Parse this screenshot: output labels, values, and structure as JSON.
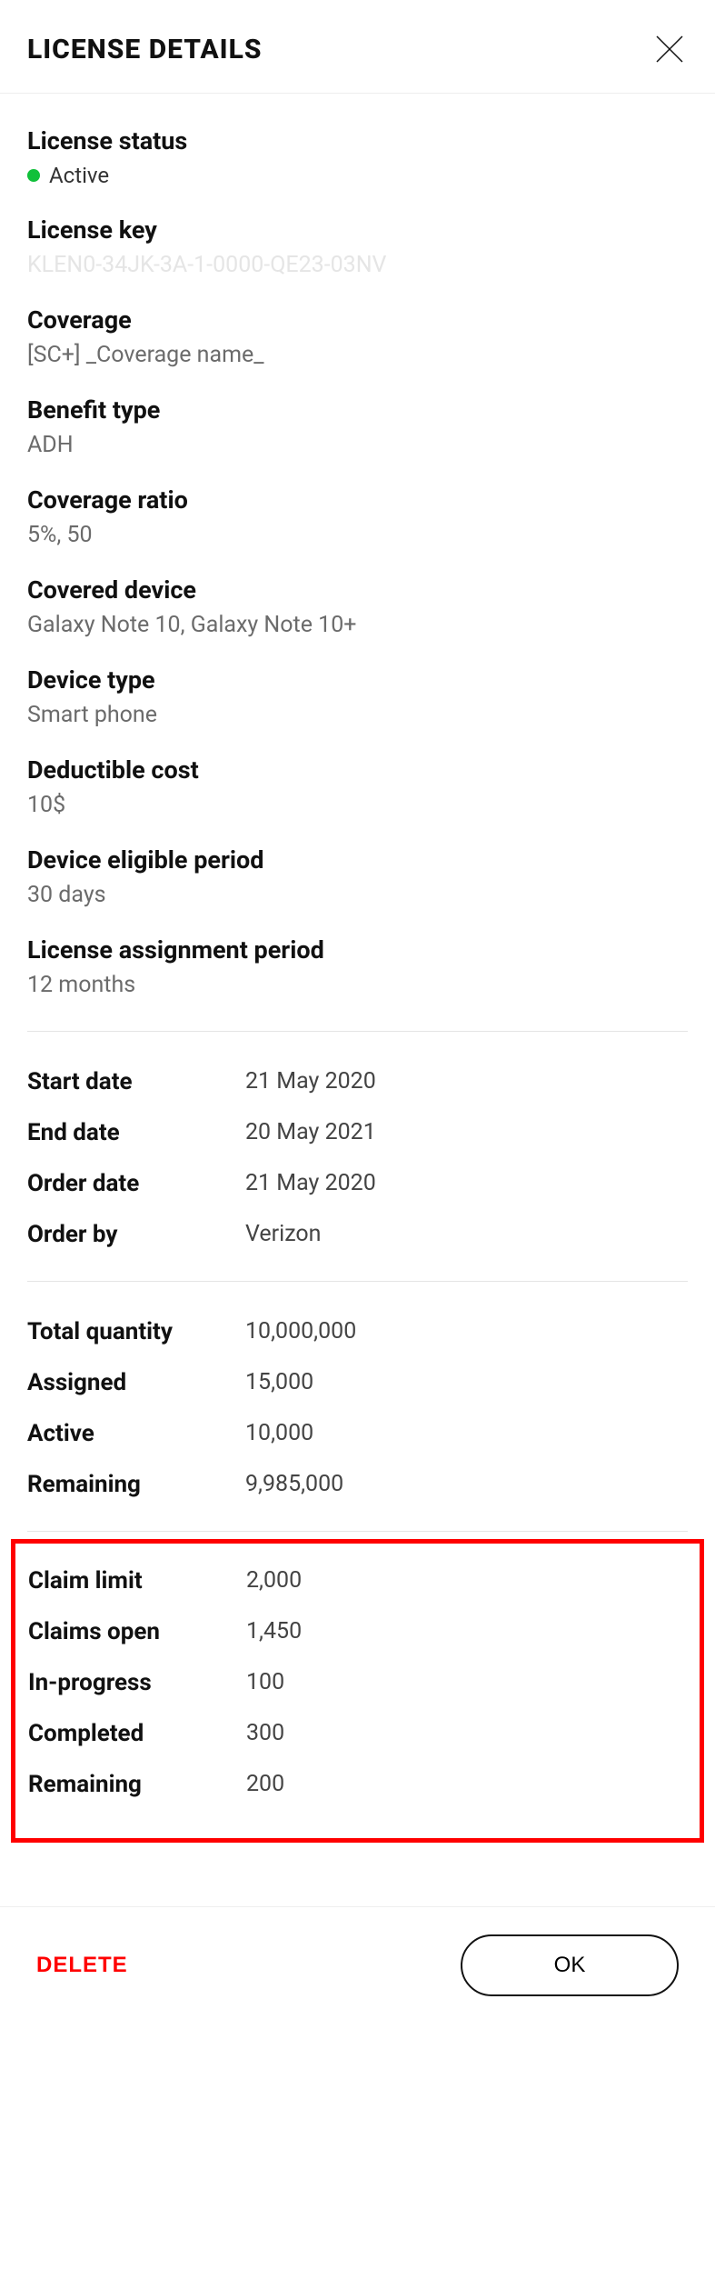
{
  "header": {
    "title": "LICENSE DETAILS"
  },
  "status": {
    "label": "License status",
    "color": "#10c03a",
    "text": "Active"
  },
  "license_key": {
    "label": "License key",
    "value": "KLEN0-34JK-3A-1-0000-QE23-03NV"
  },
  "coverage": {
    "label": "Coverage",
    "value": "[SC+] _Coverage name_"
  },
  "benefit_type": {
    "label": "Benefit type",
    "value": "ADH"
  },
  "coverage_ratio": {
    "label": "Coverage ratio",
    "value": "5%, 50"
  },
  "covered_device": {
    "label": "Covered device",
    "value": "Galaxy Note 10, Galaxy Note 10+"
  },
  "device_type": {
    "label": "Device type",
    "value": "Smart phone"
  },
  "deductible": {
    "label": "Deductible cost",
    "value": "10$"
  },
  "eligible_period": {
    "label": "Device eligible period",
    "value": "30 days"
  },
  "assignment_period": {
    "label": "License assignment period",
    "value": "12 months"
  },
  "dates": {
    "start": {
      "label": "Start date",
      "value": "21 May 2020"
    },
    "end": {
      "label": "End date",
      "value": "20 May 2021"
    },
    "order": {
      "label": "Order date",
      "value": "21 May 2020"
    },
    "order_by": {
      "label": "Order by",
      "value": "Verizon"
    }
  },
  "quantities": {
    "total": {
      "label": "Total quantity",
      "value": "10,000,000"
    },
    "assigned": {
      "label": "Assigned",
      "value": "15,000"
    },
    "active": {
      "label": "Active",
      "value": "10,000"
    },
    "remaining": {
      "label": "Remaining",
      "value": "9,985,000"
    }
  },
  "claims": {
    "limit": {
      "label": "Claim limit",
      "value": "2,000"
    },
    "open": {
      "label": "Claims open",
      "value": "1,450"
    },
    "inprogress": {
      "label": "In-progress",
      "value": "100"
    },
    "completed": {
      "label": "Completed",
      "value": "300"
    },
    "remaining": {
      "label": "Remaining",
      "value": "200"
    }
  },
  "footer": {
    "delete": "DELETE",
    "ok": "OK"
  }
}
